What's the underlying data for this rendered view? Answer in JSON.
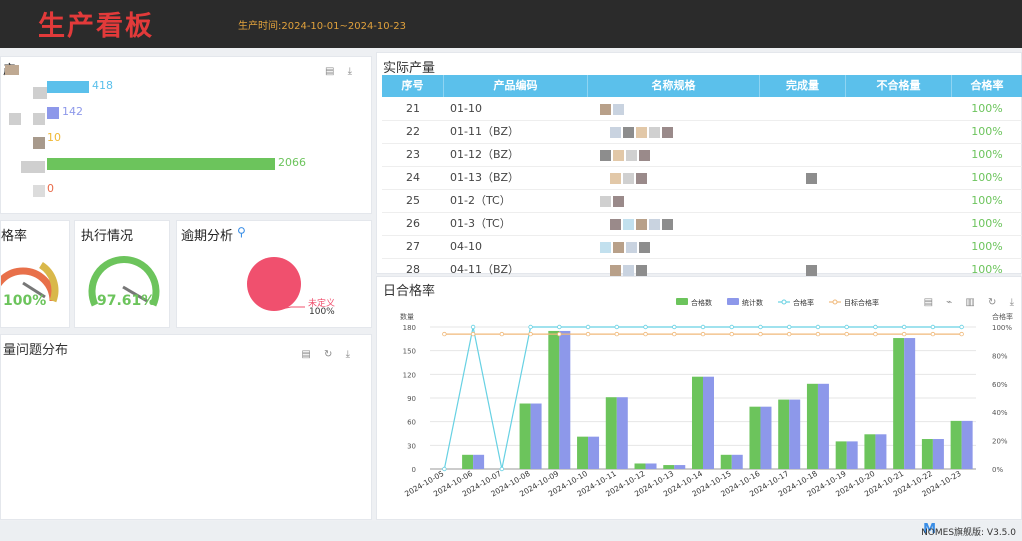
{
  "header": {
    "brand": "生产看板",
    "period": "生产时间:2024-10-01~2024-10-23"
  },
  "left_bars": {
    "title_fragment": "产",
    "items": [
      {
        "value": "418",
        "color": "#5bc0eb"
      },
      {
        "value": "142",
        "color": "#8d98ea"
      },
      {
        "value": "10",
        "color": "#f0b936"
      },
      {
        "value": "2066",
        "color": "#6cc45c"
      },
      {
        "value": "0",
        "color": "#e86b4a"
      }
    ],
    "tools": "▤ ⤓"
  },
  "gauges": {
    "pass_rate": {
      "title": "格率",
      "value": "100%"
    },
    "execution": {
      "title": "执行情况",
      "value": "97.61%"
    },
    "overdue": {
      "title": "逾期分析",
      "slice_label": "未定义",
      "slice_pct": "100%"
    }
  },
  "problem_panel": {
    "title": "量问题分布",
    "tools": "▤ ↻ ⤓"
  },
  "output_table": {
    "title": "实际产量",
    "columns": [
      "序号",
      "产品编码",
      "名称规格",
      "完成量",
      "不合格量",
      "合格率"
    ],
    "rows": [
      {
        "no": "21",
        "code": "01-10",
        "rate": "100%"
      },
      {
        "no": "22",
        "code": "01-11（BZ）",
        "rate": "100%"
      },
      {
        "no": "23",
        "code": "01-12（BZ）",
        "rate": "100%"
      },
      {
        "no": "24",
        "code": "01-13（BZ）",
        "rate": "100%"
      },
      {
        "no": "25",
        "code": "01-2（TC）",
        "rate": "100%"
      },
      {
        "no": "26",
        "code": "01-3（TC）",
        "rate": "100%"
      },
      {
        "no": "27",
        "code": "04-10",
        "rate": "100%"
      },
      {
        "no": "28",
        "code": "04-11（BZ）",
        "rate": "100%"
      }
    ]
  },
  "daily_chart": {
    "title": "日合格率",
    "tools": "▤ ⌁ ▥ ↻ ⤓"
  },
  "chart_data": {
    "type": "bar",
    "categories": [
      "2024-10-05",
      "2024-10-06",
      "2024-10-07",
      "2024-10-08",
      "2024-10-09",
      "2024-10-10",
      "2024-10-11",
      "2024-10-12",
      "2024-10-13",
      "2024-10-14",
      "2024-10-15",
      "2024-10-16",
      "2024-10-17",
      "2024-10-18",
      "2024-10-19",
      "2024-10-20",
      "2024-10-21",
      "2024-10-22",
      "2024-10-23"
    ],
    "series": [
      {
        "name": "合格数",
        "type": "bar",
        "color": "#6cc45c",
        "values": [
          0,
          18,
          0,
          83,
          175,
          41,
          91,
          7,
          5,
          117,
          18,
          79,
          88,
          108,
          35,
          44,
          166,
          38,
          61
        ]
      },
      {
        "name": "统计数",
        "type": "bar",
        "color": "#8d98ea",
        "values": [
          0,
          18,
          0,
          83,
          175,
          41,
          91,
          7,
          5,
          117,
          18,
          79,
          88,
          108,
          35,
          44,
          166,
          38,
          61
        ]
      },
      {
        "name": "合格率",
        "type": "line",
        "color": "#67d1e3",
        "values": [
          0,
          100,
          0,
          100,
          100,
          100,
          100,
          100,
          100,
          100,
          100,
          100,
          100,
          100,
          100,
          100,
          100,
          100,
          100
        ]
      },
      {
        "name": "目标合格率",
        "type": "line",
        "color": "#f0b97a",
        "values": [
          95,
          95,
          95,
          95,
          95,
          95,
          95,
          95,
          95,
          95,
          95,
          95,
          95,
          95,
          95,
          95,
          95,
          95,
          95
        ]
      }
    ],
    "ylabel": "数量",
    "y2label": "合格率",
    "ylim": [
      0,
      180
    ],
    "yticks": [
      "0",
      "30",
      "60",
      "90",
      "120",
      "150",
      "180"
    ],
    "y2lim": [
      0,
      100
    ],
    "y2ticks": [
      "0%",
      "20%",
      "40%",
      "60%",
      "80%",
      "100%"
    ],
    "legend": "top-center",
    "grid": true
  },
  "footer": {
    "version": "NOMES旗舰版: V3.5.0"
  }
}
